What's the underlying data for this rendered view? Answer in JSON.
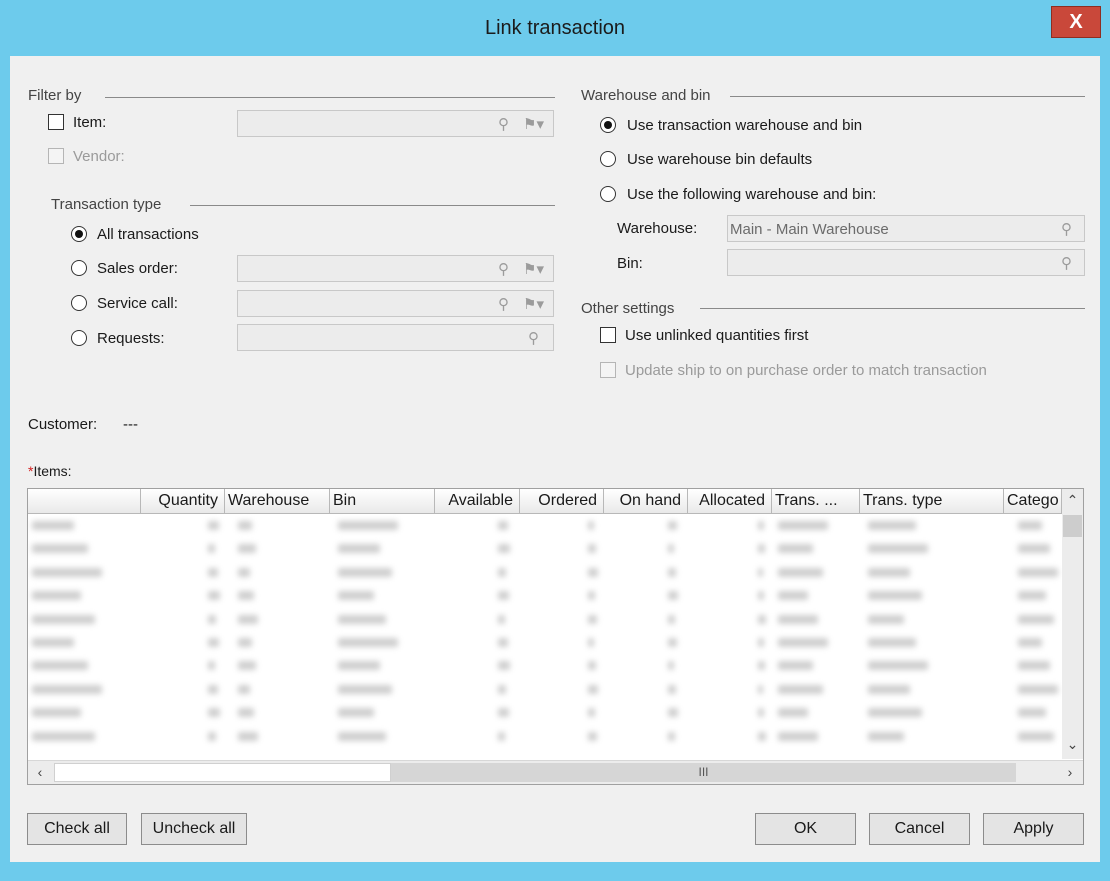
{
  "window": {
    "title": "Link transaction",
    "close_label": "X"
  },
  "filter": {
    "group_label": "Filter by",
    "item_label": "Item:",
    "vendor_label": "Vendor:"
  },
  "transaction_type": {
    "group_label": "Transaction type",
    "options": [
      "All transactions",
      "Sales order:",
      "Service call:",
      "Requests:"
    ],
    "selected": "All transactions"
  },
  "warehouse_bin": {
    "group_label": "Warehouse and bin",
    "options": [
      "Use transaction warehouse and bin",
      "Use warehouse bin defaults",
      "Use the following warehouse and bin:"
    ],
    "selected": "Use transaction warehouse and bin",
    "warehouse_label": "Warehouse:",
    "warehouse_value": "Main - Main Warehouse",
    "bin_label": "Bin:",
    "bin_value": ""
  },
  "other_settings": {
    "group_label": "Other settings",
    "unlinked_label": "Use unlinked quantities first",
    "update_ship_label": "Update ship to on purchase order to match transaction"
  },
  "customer": {
    "label": "Customer:",
    "value": "---"
  },
  "items": {
    "required_marker": "*",
    "label": "Items:",
    "columns": [
      "",
      "Quantity",
      "Warehouse",
      "Bin",
      "Available",
      "Ordered",
      "On hand",
      "Allocated",
      "Trans. ...",
      "Trans. type",
      "Catego"
    ],
    "visible_rows": 10,
    "h_scroll_grip": "III"
  },
  "buttons": {
    "check_all": "Check all",
    "uncheck_all": "Uncheck all",
    "ok": "OK",
    "cancel": "Cancel",
    "apply": "Apply"
  },
  "icons": {
    "lookup": "magnifier-icon",
    "flag_dropdown": "flag-dropdown-icon"
  }
}
